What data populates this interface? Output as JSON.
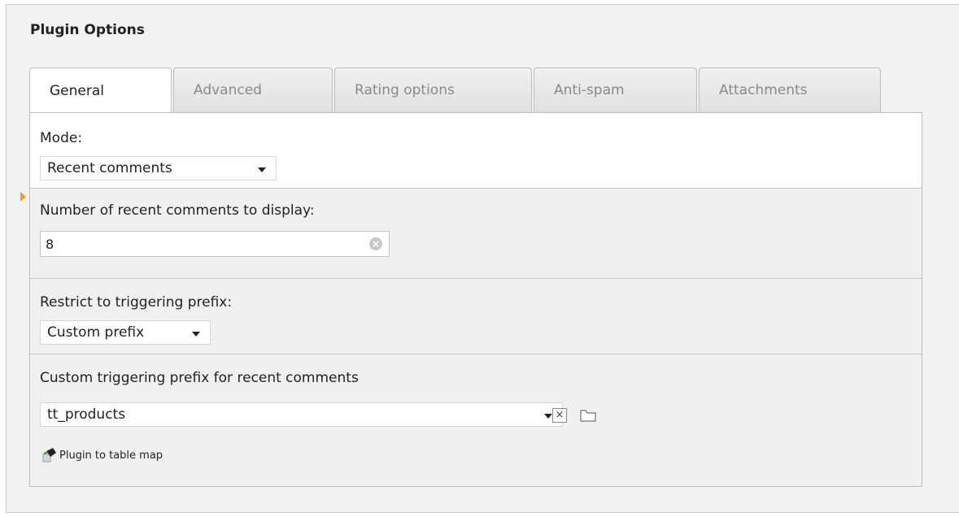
{
  "panel": {
    "title": "Plugin Options"
  },
  "tabs": [
    {
      "label": "General",
      "active": true
    },
    {
      "label": "Advanced",
      "active": false
    },
    {
      "label": "Rating options",
      "active": false
    },
    {
      "label": "Anti-spam",
      "active": false
    },
    {
      "label": "Attachments",
      "active": false
    }
  ],
  "fields": {
    "mode": {
      "label": "Mode:",
      "value": "Recent comments"
    },
    "num_comments": {
      "label": "Number of recent comments to display:",
      "value": "8"
    },
    "restrict_prefix": {
      "label": "Restrict to triggering prefix:",
      "value": "Custom prefix"
    },
    "custom_prefix": {
      "label": "Custom triggering prefix for recent comments",
      "value": "tt_products",
      "clear_glyph": "×"
    },
    "plugin_map_link": "Plugin to table map"
  },
  "icons": {
    "clear": "clear-input-icon",
    "folder": "folder-icon",
    "plugin": "typo3-plugin-icon"
  },
  "colors": {
    "marker": "#e8a020",
    "panel_bg": "#f0f0f0"
  }
}
